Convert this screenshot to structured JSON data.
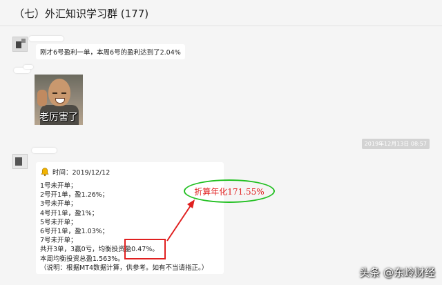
{
  "window": {
    "title": "（七）外汇知识学习群 (177)"
  },
  "messages": {
    "msg1": "刚才6号盈利一单，本周6号的盈利达到了2.04%",
    "meme_caption": "老厉害了",
    "timestamp": "2019年12月13日 08:57"
  },
  "report": {
    "time_label": "时间：2019/12/12",
    "lines": [
      "1号未开单；",
      "2号开1单，盈1.26%；",
      "3号未开单；",
      "4号开1单，盈1%；",
      "5号未开单；",
      "6号开1单，盈1.03%；",
      "7号未开单；",
      "共开3单，3赢0亏，均衡投资盈0.47%。",
      "本周均衡投资总盈1.563%。",
      "（说明：根据MT4数据计算，供参考。如有不当请指正。）"
    ]
  },
  "annotation": {
    "text": "折算年化171.55%",
    "ellipse_color": "#22c022",
    "text_color": "#e02020"
  },
  "watermark": "头条 @东岭财经",
  "colors": {
    "background": "#f5f5f5",
    "bubble": "#ffffff",
    "highlight_red": "#e02020"
  }
}
